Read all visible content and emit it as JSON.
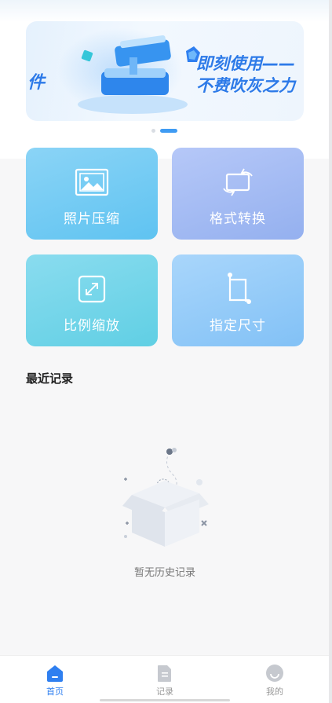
{
  "banner": {
    "partial_text": "件",
    "line1": "即刻使用——",
    "line2": "不费吹灰之力"
  },
  "carousel": {
    "count": 2,
    "active_index": 1
  },
  "tools": [
    {
      "label": "照片压缩",
      "icon": "image-icon"
    },
    {
      "label": "格式转换",
      "icon": "convert-icon"
    },
    {
      "label": "比例缩放",
      "icon": "expand-icon"
    },
    {
      "label": "指定尺寸",
      "icon": "crop-icon"
    }
  ],
  "recent": {
    "title": "最近记录",
    "empty_text": "暂无历史记录"
  },
  "tabbar": {
    "items": [
      {
        "label": "首页",
        "icon": "home-icon",
        "active": true
      },
      {
        "label": "记录",
        "icon": "document-icon",
        "active": false
      },
      {
        "label": "我的",
        "icon": "smile-icon",
        "active": false
      }
    ]
  },
  "colors": {
    "accent": "#2f7ff0",
    "banner_text": "#2d7ae8"
  }
}
